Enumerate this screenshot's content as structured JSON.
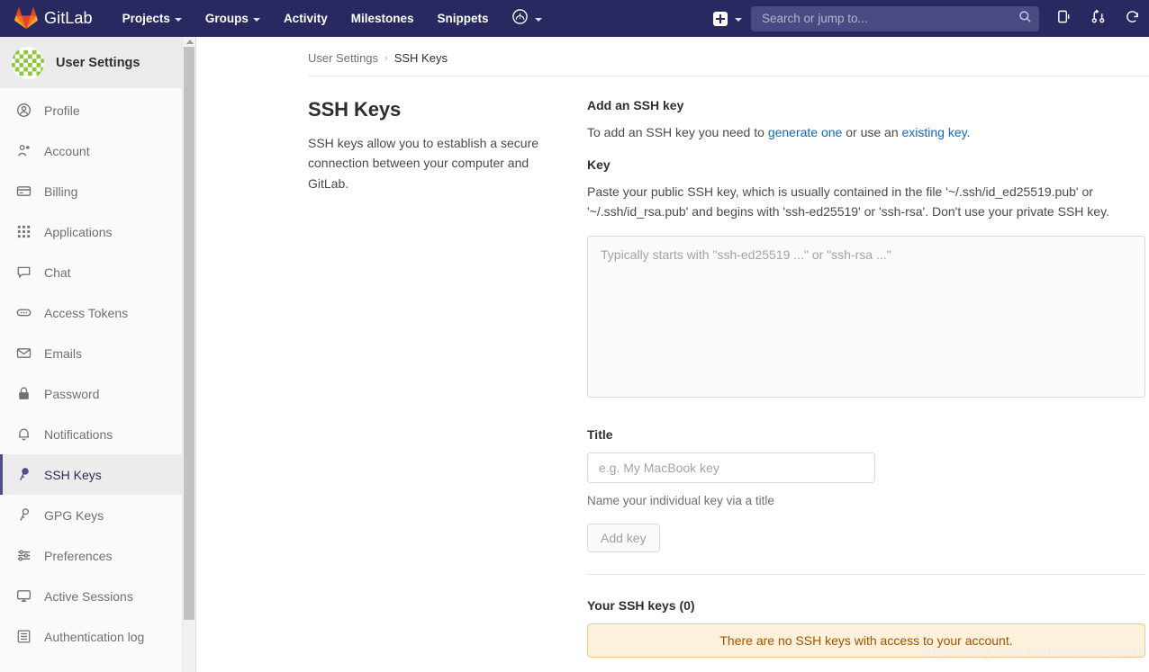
{
  "navbar": {
    "brand": "GitLab",
    "brand_logo_icon": "gitlab-tanuki-logo",
    "links": [
      {
        "label": "Projects",
        "has_caret": true
      },
      {
        "label": "Groups",
        "has_caret": true
      },
      {
        "label": "Activity",
        "has_caret": false
      },
      {
        "label": "Milestones",
        "has_caret": false
      },
      {
        "label": "Snippets",
        "has_caret": false
      }
    ],
    "help_icon": "help-circle-icon",
    "plus_icon": "plus-square-icon",
    "search": {
      "placeholder": "Search or jump to...",
      "value": "",
      "icon": "search-icon"
    },
    "right_icons": [
      {
        "name": "issues-icon"
      },
      {
        "name": "merge-requests-icon"
      },
      {
        "name": "todos-icon"
      }
    ],
    "bg_color": "#292961",
    "search_bg_color": "#4a4a82"
  },
  "sidebar": {
    "header_title": "User Settings",
    "avatar_icon": "identicon-avatar",
    "active_item": "SSH Keys",
    "active_accent_color": "#4d4d8f",
    "items": [
      {
        "label": "Profile",
        "icon": "profile-icon"
      },
      {
        "label": "Account",
        "icon": "account-icon"
      },
      {
        "label": "Billing",
        "icon": "credit-card-icon"
      },
      {
        "label": "Applications",
        "icon": "applications-grid-icon"
      },
      {
        "label": "Chat",
        "icon": "chat-bubble-icon"
      },
      {
        "label": "Access Tokens",
        "icon": "token-icon"
      },
      {
        "label": "Emails",
        "icon": "envelope-icon"
      },
      {
        "label": "Password",
        "icon": "lock-icon"
      },
      {
        "label": "Notifications",
        "icon": "bell-icon"
      },
      {
        "label": "SSH Keys",
        "icon": "key-icon"
      },
      {
        "label": "GPG Keys",
        "icon": "key-icon"
      },
      {
        "label": "Preferences",
        "icon": "sliders-icon"
      },
      {
        "label": "Active Sessions",
        "icon": "monitor-icon"
      },
      {
        "label": "Authentication log",
        "icon": "log-list-icon"
      }
    ]
  },
  "breadcrumb": {
    "parent": "User Settings",
    "separator": "›",
    "current": "SSH Keys"
  },
  "page": {
    "heading": "SSH Keys",
    "description": "SSH keys allow you to establish a secure connection between your computer and GitLab."
  },
  "form": {
    "section_title": "Add an SSH key",
    "intro_before": "To add an SSH key you need to ",
    "intro_link1": "generate one",
    "intro_middle": " or use an ",
    "intro_link2": "existing key",
    "intro_after": ".",
    "key_label": "Key",
    "key_help": "Paste your public SSH key, which is usually contained in the file '~/.ssh/id_ed25519.pub' or '~/.ssh/id_rsa.pub' and begins with 'ssh-ed25519' or 'ssh-rsa'. Don't use your private SSH key.",
    "key_placeholder": "Typically starts with \"ssh-ed25519 ...\" or \"ssh-rsa ...\"",
    "key_value": "",
    "title_label": "Title",
    "title_placeholder": "e.g. My MacBook key",
    "title_value": "",
    "title_help": "Name your individual key via a title",
    "submit_label": "Add key",
    "link_color": "#1068bf"
  },
  "keys_list": {
    "heading": "Your SSH keys (0)",
    "empty_message": "There are no SSH keys with access to your account.",
    "alert_bg_color": "#fdf1dc",
    "alert_border_color": "#f0c989",
    "alert_text_color": "#a35200"
  },
  "watermark": {
    "text": "https://blog.csdn.net/ZCShouCSDN"
  }
}
